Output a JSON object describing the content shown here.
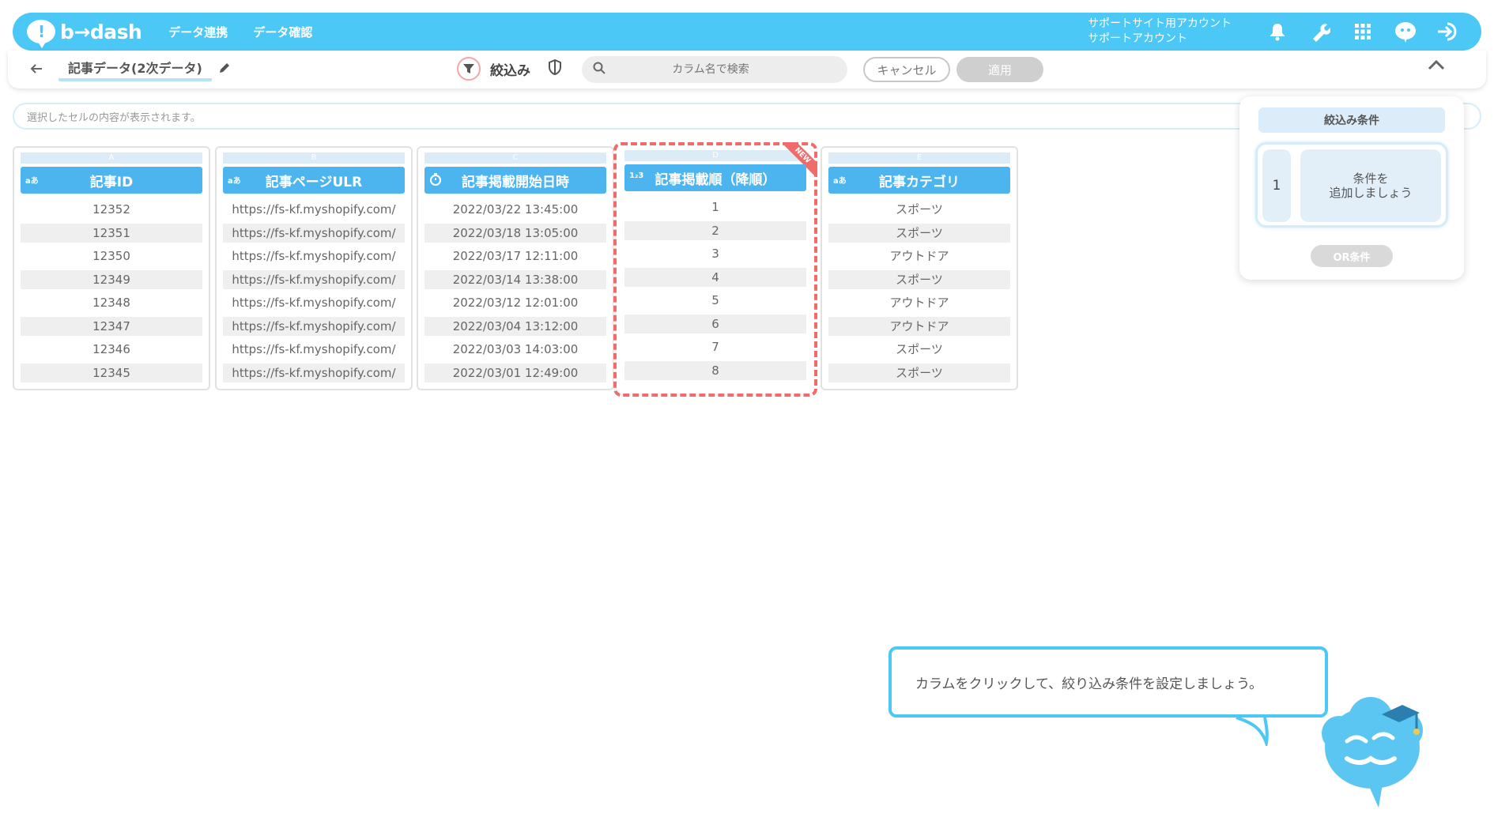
{
  "header": {
    "logo": "b→dash",
    "nav": [
      "データ連携",
      "データ確認"
    ],
    "account_line1": "サポートサイト用アカウント",
    "account_line2": "サポートアカウント"
  },
  "toolbar": {
    "title": "記事データ(2次データ)",
    "filter_label": "絞込み",
    "search_placeholder": "カラム名で検索",
    "cancel_label": "キャンセル",
    "apply_label": "適用"
  },
  "cell_bar_text": "選択したセルの内容が表示されます。",
  "columns": [
    {
      "letter": "A",
      "type": "aあ",
      "name": "記事ID",
      "rows": [
        "12352",
        "12351",
        "12350",
        "12349",
        "12348",
        "12347",
        "12346",
        "12345"
      ]
    },
    {
      "letter": "B",
      "type": "aあ",
      "name": "記事ページULR",
      "rows": [
        "https://fs-kf.myshopify.com/",
        "https://fs-kf.myshopify.com/",
        "https://fs-kf.myshopify.com/",
        "https://fs-kf.myshopify.com/",
        "https://fs-kf.myshopify.com/",
        "https://fs-kf.myshopify.com/",
        "https://fs-kf.myshopify.com/",
        "https://fs-kf.myshopify.com/"
      ]
    },
    {
      "letter": "C",
      "type": "clock",
      "name": "記事掲載開始日時",
      "rows": [
        "2022/03/22 13:45:00",
        "2022/03/18 13:05:00",
        "2022/03/17 12:11:00",
        "2022/03/14 13:38:00",
        "2022/03/12 12:01:00",
        "2022/03/04 13:12:00",
        "2022/03/03 14:03:00",
        "2022/03/01 12:49:00"
      ]
    },
    {
      "letter": "D",
      "type": "1₂3",
      "name": "記事掲載順（降順）",
      "badge": "NEW",
      "rows": [
        "1",
        "2",
        "3",
        "4",
        "5",
        "6",
        "7",
        "8"
      ]
    },
    {
      "letter": "E",
      "type": "aあ",
      "name": "記事カテゴリ",
      "rows": [
        "スポーツ",
        "スポーツ",
        "アウトドア",
        "スポーツ",
        "アウトドア",
        "アウトドア",
        "スポーツ",
        "スポーツ"
      ]
    }
  ],
  "panel": {
    "title": "絞込み条件",
    "cond_number": "1",
    "cond_add_line1": "条件を",
    "cond_add_line2": "追加しましょう",
    "or_label": "OR条件"
  },
  "tooltip": "カラムをクリックして、絞り込み条件を設定しましょう。"
}
